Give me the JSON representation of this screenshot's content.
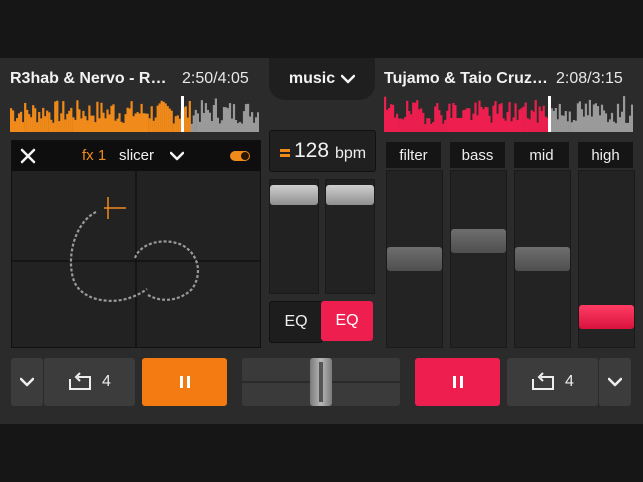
{
  "deck_left": {
    "title": "R3hab & Nervo - R…",
    "elapsed": "2:50",
    "duration": "4:05",
    "accent": "#f08a1a",
    "progress": 0.72
  },
  "deck_right": {
    "title": "Tujamo & Taio Cruz…",
    "elapsed": "2:08",
    "duration": "3:15",
    "accent": "#ee1f4f",
    "progress": 0.66
  },
  "time_separator": "/",
  "library_tab": {
    "label": "music",
    "icon": "chevron-down-icon"
  },
  "fx": {
    "close_icon": "close-icon",
    "slot": "fx 1",
    "effect": "slicer",
    "toggle_on": true
  },
  "bpm": {
    "value": "128",
    "unit": "bpm"
  },
  "pitch_faders": {
    "left_level": 0.95,
    "right_level": 0.95
  },
  "eq_toggle": {
    "left_label": "EQ",
    "right_label": "EQ",
    "active": "right"
  },
  "eq_bands": [
    {
      "label": "filter",
      "level": 0.5
    },
    {
      "label": "bass",
      "level": 0.62
    },
    {
      "label": "mid",
      "level": 0.5
    },
    {
      "label": "high",
      "level": 0.12
    }
  ],
  "transport_left": {
    "loop_count": "4",
    "play_icon": "pause-icon"
  },
  "transport_right": {
    "loop_count": "4",
    "play_icon": "pause-icon"
  },
  "crossfader": {
    "position": 0.5
  }
}
